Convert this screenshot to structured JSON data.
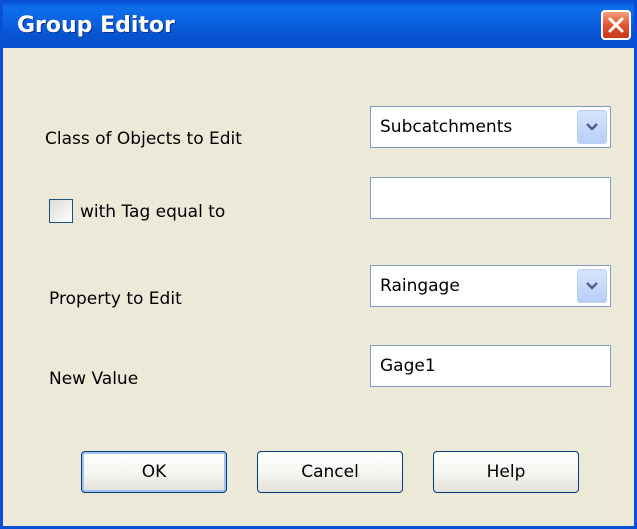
{
  "window": {
    "title": "Group Editor"
  },
  "form": {
    "class_label": "Class of Objects to Edit",
    "class_value": "Subcatchments",
    "tag_label": "with Tag equal to",
    "tag_checked": false,
    "tag_value": "",
    "property_label": "Property to Edit",
    "property_value": "Raingage",
    "new_value_label": "New Value",
    "new_value": "Gage1"
  },
  "buttons": {
    "ok": "OK",
    "cancel": "Cancel",
    "help": "Help"
  },
  "colors": {
    "titlebar": "#0a5bd8",
    "dialog_bg": "#ece9d8",
    "close": "#e0502c"
  },
  "icons": {
    "close": "close-icon",
    "dropdown": "chevron-down-icon"
  }
}
